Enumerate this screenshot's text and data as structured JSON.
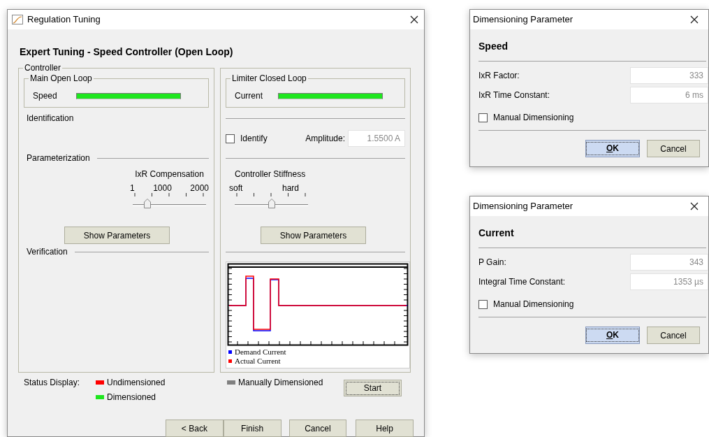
{
  "main_window": {
    "title": "Regulation Tuning",
    "heading": "Expert Tuning - Speed Controller (Open Loop)",
    "controller": {
      "label": "Controller",
      "main_loop": {
        "group": "Main Open Loop",
        "name": "Speed",
        "color": "#1ee61e"
      },
      "limiter_loop": {
        "group": "Limiter Closed Loop",
        "name": "Current",
        "color": "#1ee61e"
      },
      "identification": {
        "label": "Identification",
        "identify": {
          "label": "Identify",
          "checked": false
        },
        "amplitude": {
          "label": "Amplitude:",
          "value": "1.5500 A",
          "disabled": true
        }
      },
      "parameterization": {
        "label": "Parameterization",
        "ixr": {
          "label": "IxR Compensation",
          "ticks": [
            "1",
            "1000",
            "2000"
          ],
          "level": 0.2
        },
        "stiffness": {
          "label": "Controller Stiffness",
          "ticks": [
            "soft",
            "hard"
          ],
          "level": 0.5
        }
      },
      "show_parameters": [
        "Show Parameters",
        "Show Parameters"
      ],
      "verification": {
        "label": "Verification",
        "legend": [
          {
            "label": "Demand Current",
            "color": "#0000ff"
          },
          {
            "label": "Actual Current",
            "color": "#ff0000"
          }
        ]
      }
    },
    "status_display": {
      "label": "Status Display:",
      "items": [
        {
          "label": "Undimensioned",
          "color": "#ff0000"
        },
        {
          "label": "Dimensioned",
          "color": "#1ee61e"
        },
        {
          "label": "Manually Dimensioned",
          "color": "#808080"
        }
      ]
    },
    "start_button": "Start",
    "buttons": [
      "< Back",
      "Finish",
      "Cancel",
      "Help"
    ]
  },
  "dialogs": [
    {
      "title": "Dimensioning Parameter",
      "heading": "Speed",
      "fields": [
        {
          "label": "IxR Factor:",
          "value": "333",
          "disabled": true
        },
        {
          "label": "IxR Time Constant:",
          "value": "6 ms",
          "disabled": true
        }
      ],
      "manual": {
        "label": "Manual Dimensioning",
        "checked": false
      },
      "buttons": [
        {
          "label": "OK",
          "default": true
        },
        {
          "label": "Cancel",
          "default": false
        }
      ]
    },
    {
      "title": "Dimensioning Parameter",
      "heading": "Current",
      "fields": [
        {
          "label": "P Gain:",
          "value": "343",
          "disabled": true
        },
        {
          "label": "Integral Time Constant:",
          "value": "1353 µs",
          "disabled": true
        }
      ],
      "manual": {
        "label": "Manual Dimensioning",
        "checked": false
      },
      "buttons": [
        {
          "label": "OK",
          "default": true
        },
        {
          "label": "Cancel",
          "default": false
        }
      ]
    }
  ]
}
